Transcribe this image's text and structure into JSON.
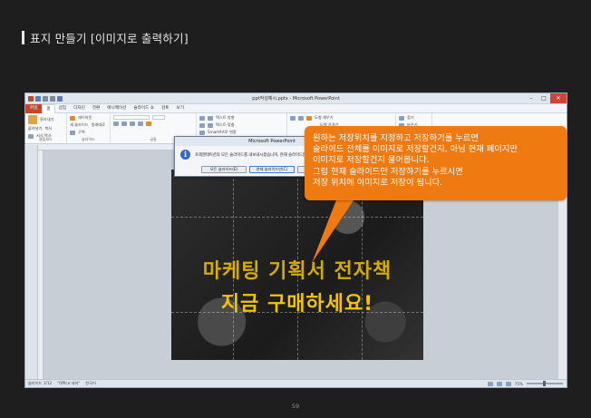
{
  "heading": {
    "text": "표지 만들기 [이미지로 출력하기]"
  },
  "window": {
    "title": "ppt작성예시.pptx - Microsoft PowerPoint",
    "min": "–",
    "max": "□",
    "close": "✕"
  },
  "menu": {
    "tabs": [
      "파일",
      "홈",
      "삽입",
      "디자인",
      "전환",
      "애니메이션",
      "슬라이드 쇼",
      "검토",
      "보기"
    ]
  },
  "ribbon": {
    "clipboard": {
      "paste": "붙여넣기",
      "cut": "잘라내기",
      "copy": "복사",
      "format_painter": "서식 복사",
      "label": "클립보드"
    },
    "slides": {
      "layout": "레이아웃",
      "reset": "원래대로",
      "section": "구역",
      "new_slide": "새 슬라이드",
      "label": "슬라이드"
    },
    "font": {
      "label": "글꼴"
    },
    "paragraph": {
      "text_direction": "텍스트 방향",
      "align_text": "텍스트 맞춤",
      "smartart": "SmartArt로 변환",
      "label": "단락"
    },
    "drawing": {
      "fill": "도형 채우기",
      "outline": "도형 윤곽선",
      "effects": "도형 효과",
      "label": "그리기"
    },
    "editing": {
      "find": "찾기",
      "replace": "바꾸기",
      "label": "편집"
    }
  },
  "dialog": {
    "title": "Microsoft PowerPoint",
    "message": "프레젠테이션의 모든 슬라이드를 내보내시겠습니까, 현재 슬라이드만 내보내시겠습니까?",
    "buttons": [
      "모든 슬라이드(E)",
      "현재 슬라이드만(C)",
      "취소"
    ]
  },
  "slide": {
    "line1": "마케팅 기획서 전자책",
    "line2": "지금 구매하세요!"
  },
  "statusbar": {
    "slide_info": "슬라이드 1/12",
    "theme": "\"Office 테마\"",
    "language": "한국어",
    "zoom": "75%"
  },
  "callout": {
    "lines": [
      "원하는 저장위치를 지정하고 저장하기를 누르면",
      "슬라이드 전체를 이미지로 저장할건지, 아님 현재 페이지만",
      "이미지로 저장할건지 물어봅니다.",
      "그럼 현재 슬라이드만 저장하기를 누르시면",
      "저장 위치에 이미지로 저장이 됩니다."
    ],
    "color": "#f07a12"
  },
  "page_number": "59"
}
